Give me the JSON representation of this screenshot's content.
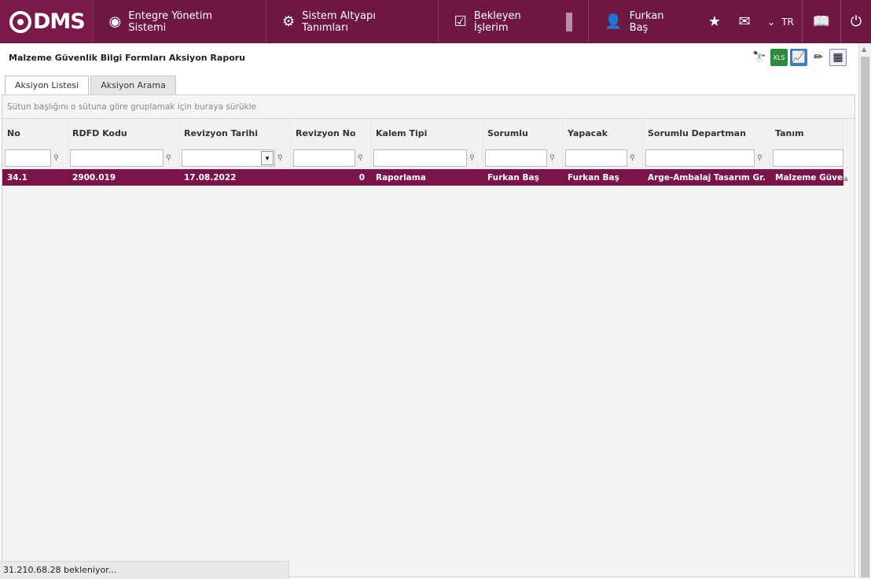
{
  "topbar": {
    "logo": "DMS",
    "nav": [
      {
        "label": "Entegre Yönetim Sistemi",
        "icon": "q-logo-icon"
      },
      {
        "label": "Sistem Altyapı Tanımları",
        "icon": "gear-icon"
      },
      {
        "label": "Bekleyen İşlerim",
        "icon": "clipboard-icon"
      }
    ],
    "user": "Furkan Baş",
    "lang": "TR"
  },
  "page": {
    "title": "Malzeme Güvenlik Bilgi Formları Aksiyon Raporu"
  },
  "tabs": [
    {
      "label": "Aksiyon Listesi",
      "active": true
    },
    {
      "label": "Aksiyon Arama",
      "active": false
    }
  ],
  "grid": {
    "group_hint": "Sütun başlığını o sütuna göre gruplamak için buraya sürükle",
    "columns": [
      "No",
      "RDFD Kodu",
      "Revizyon Tarihi",
      "Revizyon No",
      "Kalem Tipi",
      "Sorumlu",
      "Yapacak",
      "Sorumlu Departman",
      "Tanım"
    ],
    "rows": [
      [
        "34.1",
        "2900.019",
        "17.08.2022",
        "0",
        "Raporlama",
        "Furkan Baş",
        "Furkan Baş",
        "Arge-Ambalaj Tasarım Gr.",
        "Malzeme Güvenlik"
      ]
    ]
  },
  "status": "31.210.68.28 bekleniyor..."
}
